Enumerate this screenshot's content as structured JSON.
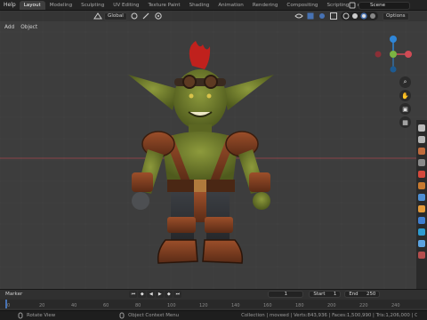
{
  "topbar": {
    "menu_help": "Help",
    "workspaces": [
      "Layout",
      "Modeling",
      "Sculpting",
      "UV Editing",
      "Texture Paint",
      "Shading",
      "Animation",
      "Rendering",
      "Compositing",
      "Scripting"
    ],
    "active_index": 0,
    "more": "▸",
    "scene_name": "Scene"
  },
  "viewport_header": {
    "transform_orientation": "Global",
    "options_label": "Options",
    "add_label": "Add",
    "object_label": "Object"
  },
  "gizmo": {
    "y_axis": "Y",
    "x_axis": "X",
    "z_axis": "Z"
  },
  "timeline": {
    "marker_menu": "Marker",
    "current_frame": "1",
    "start_label": "Start",
    "start_value": "1",
    "end_label": "End",
    "end_value": "250",
    "ruler_ticks": [
      "0",
      "20",
      "40",
      "60",
      "80",
      "100",
      "120",
      "140",
      "160",
      "180",
      "200",
      "220",
      "240"
    ]
  },
  "statusbar": {
    "left_hint": "Rotate View",
    "mid_hint": "Object Context Menu",
    "stats": "Collection | moveed | Verts:843,936 | Faces:1,500,990 | Tris:1,206,000 | Ob"
  },
  "colors": {
    "accent": "#4772b3",
    "x_axis": "#d14b55",
    "y_axis": "#7cb342",
    "z_axis": "#2f86d8"
  }
}
